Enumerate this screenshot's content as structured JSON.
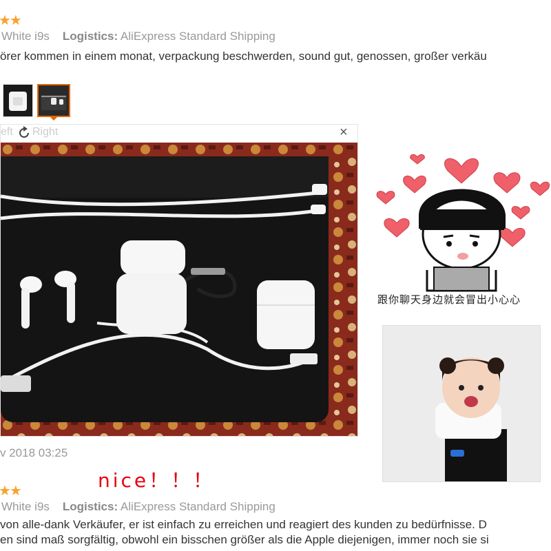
{
  "review1": {
    "rating": 2,
    "color_value": "White i9s",
    "logistics_label": "Logistics:",
    "logistics_value": "AliExpress Standard Shipping",
    "text": "örer kommen in einem monat, verpackung beschwerden, sound gut, genossen, großer verkäu",
    "rotate_left": "eft",
    "rotate_right": "Right",
    "close": "×",
    "date": "v 2018 03:25"
  },
  "overlay": {
    "nice_text": "nice！！！",
    "sticker_caption": "跟你聊天身边就会冒出小心心"
  },
  "review2": {
    "rating": 2,
    "color_value": "White i9s",
    "logistics_label": "Logistics:",
    "logistics_value": "AliExpress Standard Shipping",
    "line1": "von alle-dank Verkäufer, er ist einfach zu erreichen und reagiert des kunden zu bedürfnisse. D",
    "line2": "en sind maß sorgfältig, obwohl ein bisschen größer als die Apple diejenigen, immer noch sie si"
  },
  "colors": {
    "star": "#f7a22f",
    "accent": "#e56600",
    "nice": "#e60012",
    "heart": "#f0606a"
  }
}
